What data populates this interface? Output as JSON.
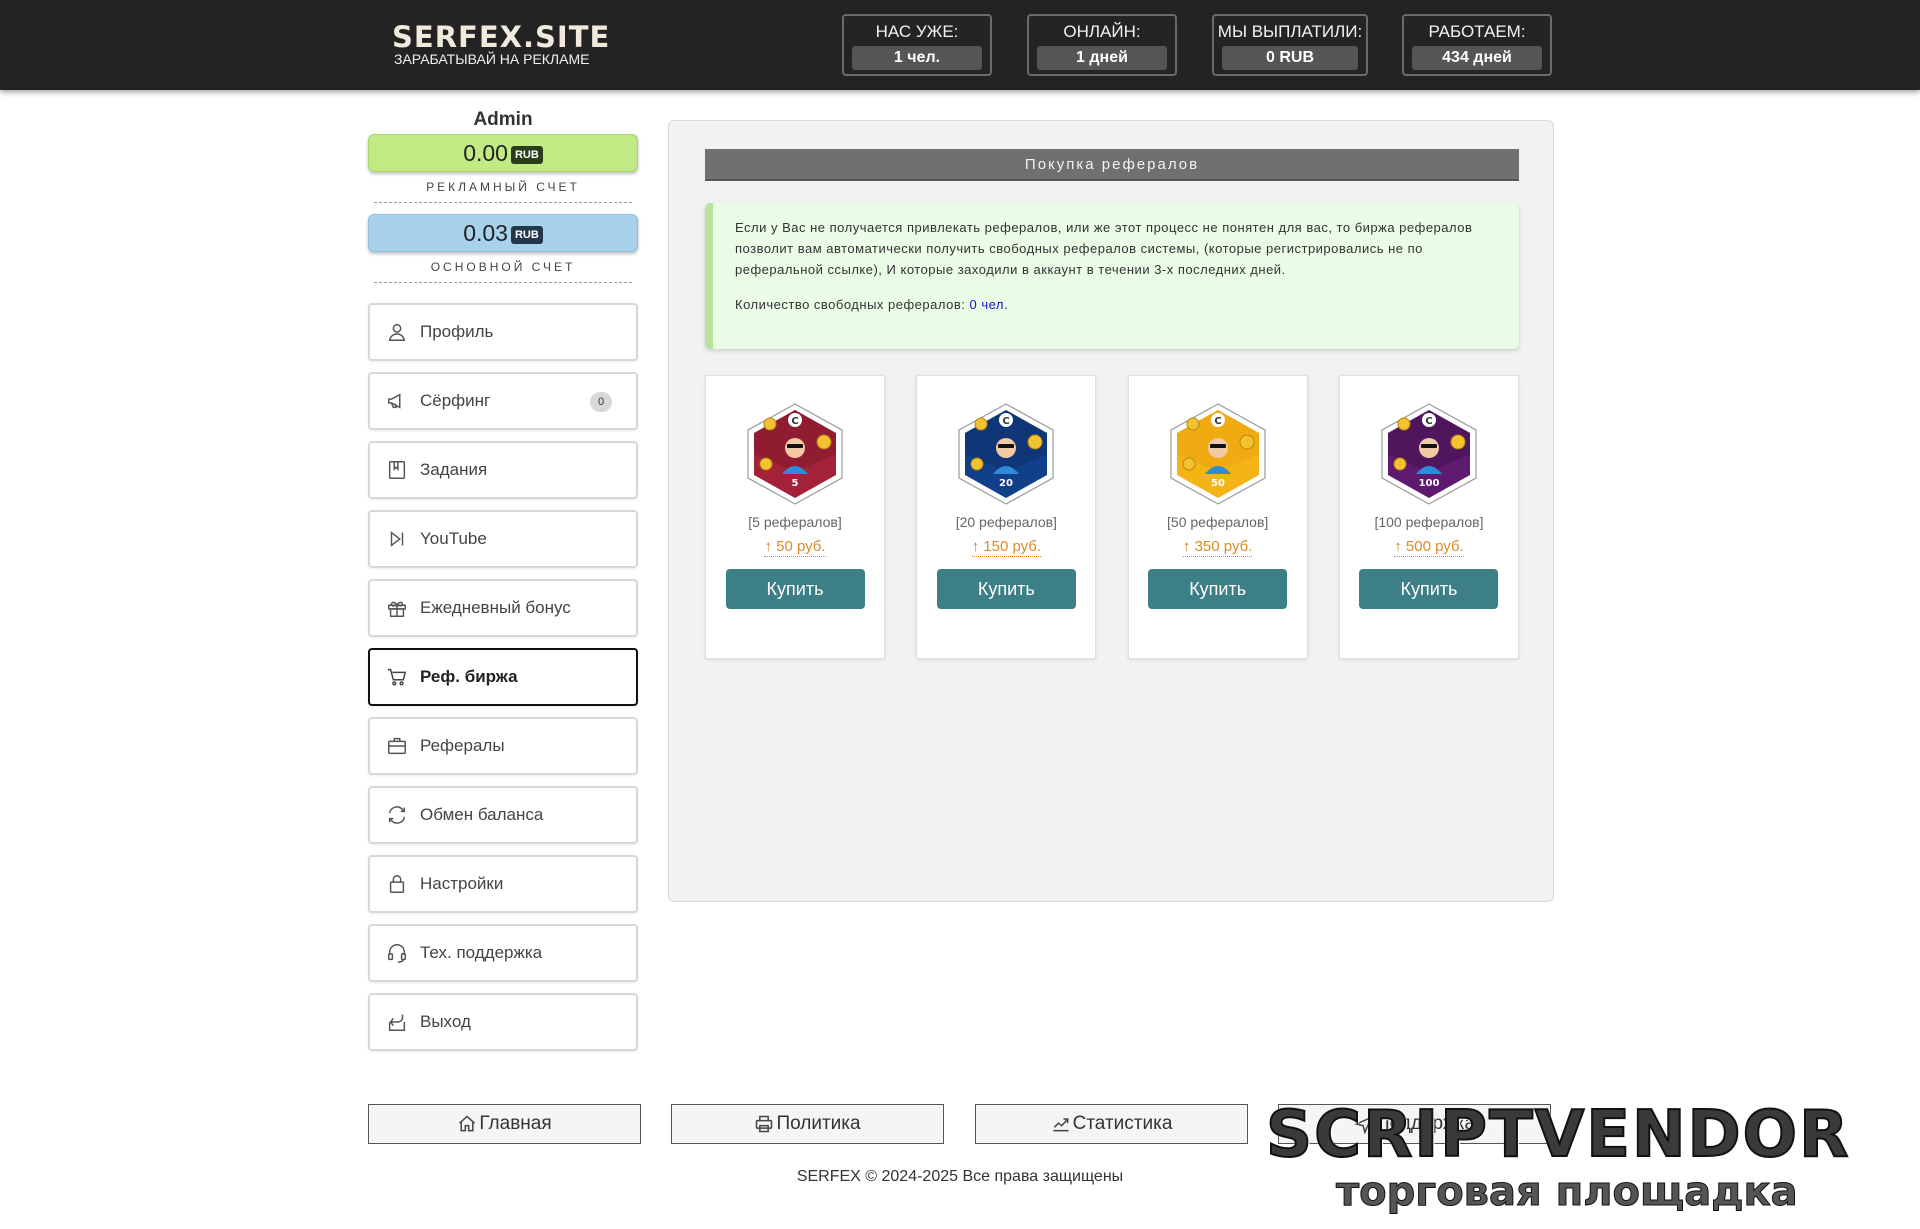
{
  "header": {
    "logo_title": "SERFEX.SITE",
    "logo_subtitle": "ЗАРАБАТЫВАЙ НА РЕКЛАМЕ",
    "stats": [
      {
        "label": "НАС УЖЕ:",
        "value": "1 чел."
      },
      {
        "label": "ОНЛАЙН:",
        "value": "1 дней"
      },
      {
        "label": "МЫ ВЫПЛАТИЛИ:",
        "value": "0 RUB"
      },
      {
        "label": "РАБОТАЕМ:",
        "value": "434 дней"
      }
    ]
  },
  "sidebar": {
    "username": "Admin",
    "ad_balance": {
      "amount": "0.00",
      "currency": "RUB",
      "label": "РЕКЛАМНЫЙ СЧЕТ",
      "color": "#c2ea84"
    },
    "main_balance": {
      "amount": "0.03",
      "currency": "RUB",
      "label": "ОСНОВНОЙ СЧЕТ",
      "color": "#a8d2ec"
    },
    "items": [
      {
        "label": "Профиль",
        "icon": "user-icon"
      },
      {
        "label": "Сёрфинг",
        "icon": "megaphone-icon",
        "badge": "0"
      },
      {
        "label": "Задания",
        "icon": "book-icon"
      },
      {
        "label": "YouTube",
        "icon": "play-skip-icon"
      },
      {
        "label": "Ежедневный бонус",
        "icon": "gift-icon"
      },
      {
        "label": "Реф. биржа",
        "icon": "cart-icon",
        "active": true
      },
      {
        "label": "Рефералы",
        "icon": "briefcase-icon"
      },
      {
        "label": "Обмен баланса",
        "icon": "exchange-icon"
      },
      {
        "label": "Настройки",
        "icon": "lock-icon"
      },
      {
        "label": "Тех. поддержка",
        "icon": "headset-icon"
      },
      {
        "label": "Выход",
        "icon": "logout-icon"
      }
    ]
  },
  "main": {
    "title": "Покупка рефералов",
    "info_text": "Если у Вас не получается привлекать рефералов, или же этот процесс не понятен для вас, то биржа рефералов позволит вам автоматически получить свободных рефералов системы, (которые регистрировались не по реферальной ссылке), И которые заходили в аккаунт в течении 3-х последних дней.",
    "free_refs_label": "Количество свободных рефералов:",
    "free_refs_value": "0 чел.",
    "packages": [
      {
        "badge_number": "5",
        "refs": "[5 рефералов]",
        "price": "50 руб.",
        "buy_label": "Купить",
        "color": "#a3223a",
        "color2": "#6e1226"
      },
      {
        "badge_number": "20",
        "refs": "[20 рефералов]",
        "price": "150 руб.",
        "buy_label": "Купить",
        "color": "#123f8a",
        "color2": "#0b2450"
      },
      {
        "badge_number": "50",
        "refs": "[50 рефералов]",
        "price": "350 руб.",
        "buy_label": "Купить",
        "color": "#f4b416",
        "color2": "#e59a08"
      },
      {
        "badge_number": "100",
        "refs": "[100 рефералов]",
        "price": "500 руб.",
        "buy_label": "Купить",
        "color": "#5e1a6e",
        "color2": "#36103f"
      }
    ]
  },
  "footer": {
    "nav": [
      {
        "label": "Главная",
        "icon": "home-icon"
      },
      {
        "label": "Политика",
        "icon": "print-icon"
      },
      {
        "label": "Статистика",
        "icon": "chart-icon"
      },
      {
        "label": "Поддержка",
        "icon": "support-icon"
      }
    ],
    "copyright": "SERFEX © 2024-2025 Все права защищены"
  },
  "watermark": {
    "title": "SCRIPTVENDOR",
    "subtitle": "торговая площадка"
  }
}
